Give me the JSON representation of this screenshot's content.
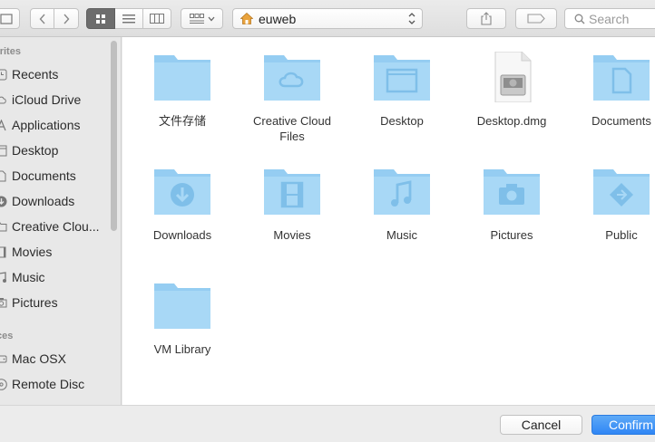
{
  "toolbar": {
    "location": "euweb",
    "search_placeholder": "Search"
  },
  "sidebar": {
    "favorites_header": "orites",
    "favorites": [
      {
        "label": "Recents",
        "icon": "clock-icon"
      },
      {
        "label": "iCloud Drive",
        "icon": "cloud-icon"
      },
      {
        "label": "Applications",
        "icon": "applications-icon"
      },
      {
        "label": "Desktop",
        "icon": "desktop-icon"
      },
      {
        "label": "Documents",
        "icon": "document-icon"
      },
      {
        "label": "Downloads",
        "icon": "download-icon"
      },
      {
        "label": "Creative Clou...",
        "icon": "folder-icon"
      },
      {
        "label": "Movies",
        "icon": "film-icon"
      },
      {
        "label": "Music",
        "icon": "music-icon"
      },
      {
        "label": "Pictures",
        "icon": "camera-icon"
      }
    ],
    "devices_header": "ices",
    "devices": [
      {
        "label": "Mac OSX",
        "icon": "hard-drive-icon"
      },
      {
        "label": "Remote Disc",
        "icon": "disc-icon"
      }
    ]
  },
  "files": [
    {
      "name": "文件存储",
      "glyph": "none"
    },
    {
      "name": "Creative Cloud Files",
      "glyph": "creative-cloud"
    },
    {
      "name": "Desktop",
      "glyph": "desktop"
    },
    {
      "name": "Desktop.dmg",
      "glyph": "dmg"
    },
    {
      "name": "Documents",
      "glyph": "document"
    },
    {
      "name": "Downloads",
      "glyph": "download"
    },
    {
      "name": "Movies",
      "glyph": "film"
    },
    {
      "name": "Music",
      "glyph": "music"
    },
    {
      "name": "Pictures",
      "glyph": "camera"
    },
    {
      "name": "Public",
      "glyph": "public"
    },
    {
      "name": "VM Library",
      "glyph": "none"
    }
  ],
  "footer": {
    "cancel_label": "Cancel",
    "confirm_label": "Confirm"
  },
  "colors": {
    "folder_body": "#a8d8f6",
    "folder_tab": "#95cdf2",
    "folder_glyph": "#7fbfe9",
    "accent": "#2f86f5"
  }
}
